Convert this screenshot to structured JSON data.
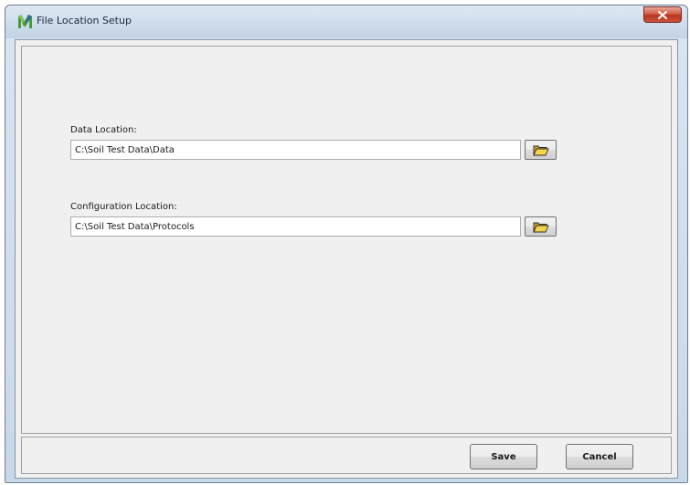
{
  "window": {
    "title": "File Location Setup",
    "icon": "app-logo-icon"
  },
  "data_location": {
    "label": "Data Location:",
    "value": "C:\\Soil Test Data\\Data",
    "browse_icon": "folder-open-icon"
  },
  "config_location": {
    "label": "Configuration Location:",
    "value": "C:\\Soil Test Data\\Protocols",
    "browse_icon": "folder-open-icon"
  },
  "buttons": {
    "save": "Save",
    "cancel": "Cancel"
  },
  "colors": {
    "close_button": "#c9533b",
    "dialog_background": "#f0f0f0",
    "folder_icon": "#e8c43a"
  }
}
